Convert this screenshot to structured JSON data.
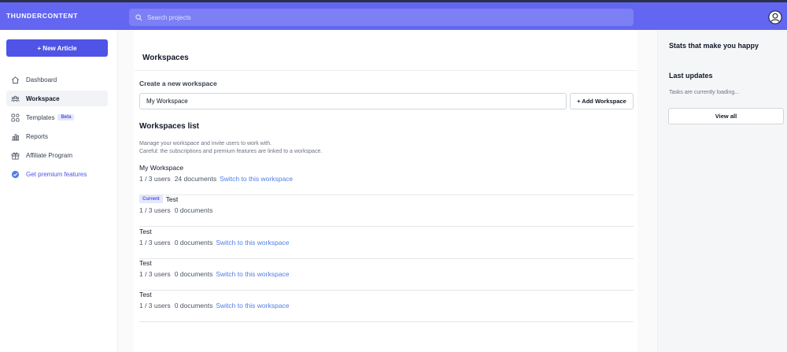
{
  "header": {
    "brand": "THUNDERCONTENT",
    "search_placeholder": "Search projects"
  },
  "sidebar": {
    "new_article": "+ New Article",
    "items": [
      {
        "label": "Dashboard",
        "icon": "home-icon"
      },
      {
        "label": "Workspace",
        "icon": "team-icon",
        "active": true
      },
      {
        "label": "Templates",
        "icon": "grid-icon",
        "badge": "Beta"
      },
      {
        "label": "Reports",
        "icon": "bar-chart-icon"
      },
      {
        "label": "Affiliate Program",
        "icon": "gift-icon"
      },
      {
        "label": "Get premium features",
        "icon": "check-badge-icon"
      }
    ]
  },
  "main": {
    "title": "Workspaces",
    "create_label": "Create a new workspace",
    "input_value": "My Workspace",
    "add_button": "+ Add Workspace",
    "list_title": "Workspaces list",
    "desc_line1": "Manage your workspace and invite users to work with.",
    "desc_line2": "Careful: the subscriptions and premium features are linked to a workspace.",
    "switch_label": "Switch to this workspace",
    "current_badge": "Current",
    "workspaces": [
      {
        "name": "My Workspace",
        "users": "1 / 3 users",
        "docs": "24 documents",
        "current": false
      },
      {
        "name": "Test",
        "users": "1 / 3 users",
        "docs": "0 documents",
        "current": true
      },
      {
        "name": "Test",
        "users": "1 / 3 users",
        "docs": "0 documents",
        "current": false
      },
      {
        "name": "Test",
        "users": "1 / 3 users",
        "docs": "0 documents",
        "current": false
      },
      {
        "name": "Test",
        "users": "1 / 3 users",
        "docs": "0 documents",
        "current": false
      }
    ]
  },
  "right_panel": {
    "stats_title": "Stats that make you happy",
    "updates_title": "Last updates",
    "loading_text": "Tasks are currently loading...",
    "view_all": "View all"
  },
  "colors": {
    "topbar": "#6366f1",
    "primary": "#4f54e6",
    "link": "#4f7ee6"
  }
}
